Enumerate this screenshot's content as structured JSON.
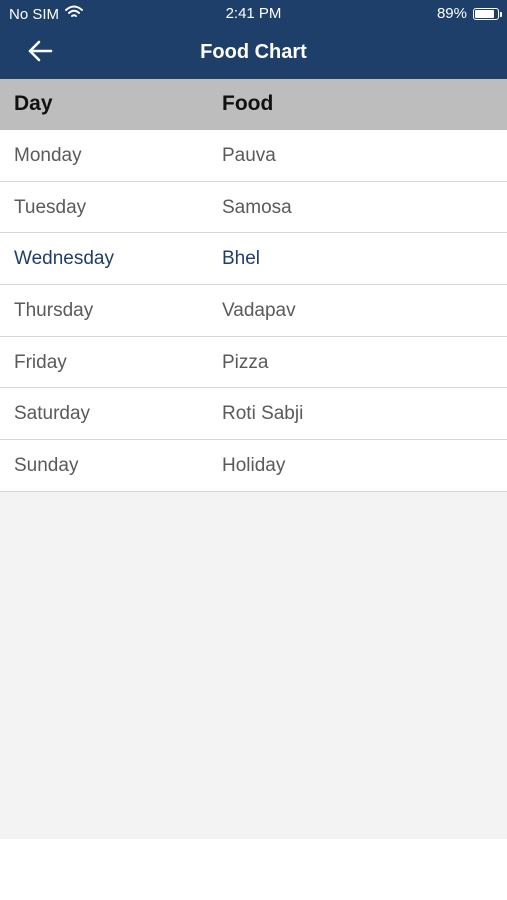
{
  "status": {
    "carrier": "No SIM",
    "time": "2:41 PM",
    "battery": "89%"
  },
  "nav": {
    "title": "Food Chart"
  },
  "table": {
    "headers": {
      "day": "Day",
      "food": "Food"
    },
    "rows": [
      {
        "day": "Monday",
        "food": "Pauva"
      },
      {
        "day": "Tuesday",
        "food": "Samosa"
      },
      {
        "day": "Wednesday",
        "food": "Bhel"
      },
      {
        "day": "Thursday",
        "food": "Vadapav"
      },
      {
        "day": "Friday",
        "food": "Pizza"
      },
      {
        "day": "Saturday",
        "food": "Roti Sabji"
      },
      {
        "day": "Sunday",
        "food": "Holiday"
      }
    ],
    "selected_index": 2
  },
  "colors": {
    "header_bg": "#1f3f6b",
    "table_head_bg": "#bdbdbd",
    "selected_text": "#1f3f6b",
    "row_text": "#5a5a5a",
    "empty_bg": "#f3f3f3"
  },
  "icons": {
    "back": "arrow-left-icon",
    "wifi": "wifi-icon",
    "battery": "battery-icon"
  }
}
